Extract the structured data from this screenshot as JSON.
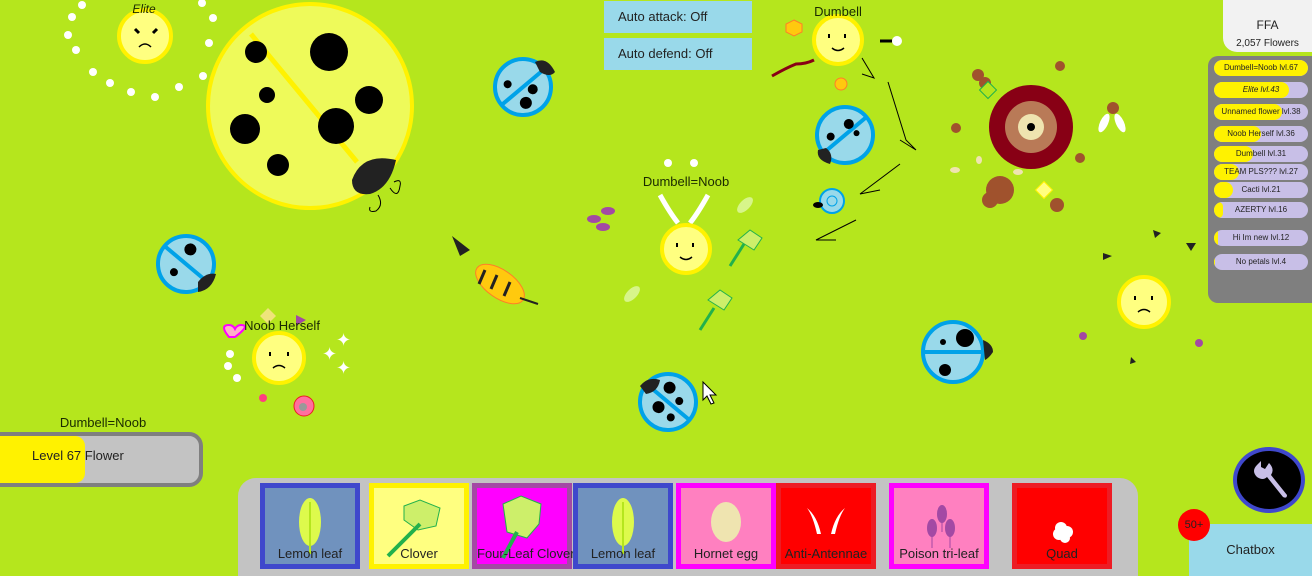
{
  "mode_panel": {
    "mode": "FFA",
    "player_count": "2,057 Flowers"
  },
  "toggles": {
    "auto_attack": "Auto attack: Off",
    "auto_defend": "Auto defend: Off"
  },
  "players": [
    {
      "name": "Elite",
      "italic": true
    },
    {
      "name": "Dumbell",
      "italic": false
    },
    {
      "name": "Dumbell=Noob",
      "italic": false
    },
    {
      "name": "Noob Herself",
      "italic": false
    }
  ],
  "leaderboard": [
    {
      "label": "Dumbell=Noob lvl.67",
      "fill": 1.0,
      "italic": false
    },
    {
      "label": "Elite lvl.43",
      "fill": 0.8,
      "italic": true
    },
    {
      "label": "Unnamed flower lvl.38",
      "fill": 0.72,
      "italic": false
    },
    {
      "label": "Noob Herself lvl.36",
      "fill": 0.5,
      "italic": false
    },
    {
      "label": "Dumbell lvl.31",
      "fill": 0.42,
      "italic": false
    },
    {
      "label": "TEAM PLS??? lvl.27",
      "fill": 0.27,
      "italic": false
    },
    {
      "label": "Cacti lvl.21",
      "fill": 0.2,
      "italic": false
    },
    {
      "label": "AZERTY lvl.16",
      "fill": 0.1,
      "italic": false
    },
    {
      "label": "Hi Im new lvl.12",
      "fill": 0.04,
      "italic": false
    },
    {
      "label": "No petals lvl.4",
      "fill": 0.01,
      "italic": false
    }
  ],
  "level": {
    "player_name": "Dumbell=Noob",
    "text": "Level 67 Flower",
    "progress": 0.45
  },
  "hotbar": [
    {
      "label": "Lemon leaf",
      "icon": "lemon-leaf-icon",
      "bg": "#7092be",
      "border": "#3f48cc"
    },
    {
      "label": "Clover",
      "icon": "clover-icon",
      "bg": "#ffff80",
      "border": "#fff200"
    },
    {
      "label": "Four-Leaf Clover",
      "icon": "four-leaf-clover-icon",
      "bg": "#ff00ff",
      "border": "#a349a4"
    },
    {
      "label": "Lemon leaf",
      "icon": "lemon-leaf-icon",
      "bg": "#7092be",
      "border": "#3f48cc"
    },
    {
      "label": "Hornet egg",
      "icon": "hornet-egg-icon",
      "bg": "#ff80c0",
      "border": "#ff00ff"
    },
    {
      "label": "Anti-Antennae",
      "icon": "anti-antennae-icon",
      "bg": "#ff0000",
      "border": "#ed1c24"
    },
    {
      "label": "Poison tri-leaf",
      "icon": "poison-tri-leaf-icon",
      "bg": "#ff80c0",
      "border": "#ff00ff"
    },
    {
      "label": "Quad",
      "icon": "quad-icon",
      "bg": "#ff0000",
      "border": "#ed1c24"
    }
  ],
  "chat": {
    "label": "Chatbox",
    "unread_badge": "50+"
  },
  "settings": {
    "icon": "wrench-icon"
  },
  "colors": {
    "background": "#b5e61d",
    "flower_fill": "#ffff80",
    "flower_outline": "#fff200",
    "ladybug_blue": "#99d9ea",
    "ladybug_blue_outline": "#00a2e8",
    "panel_blue": "#99d9ea",
    "leaderboard_bg": "#7f7f7f",
    "leaderboard_row": "#c8bfe7",
    "progress_fill": "#fff200"
  }
}
